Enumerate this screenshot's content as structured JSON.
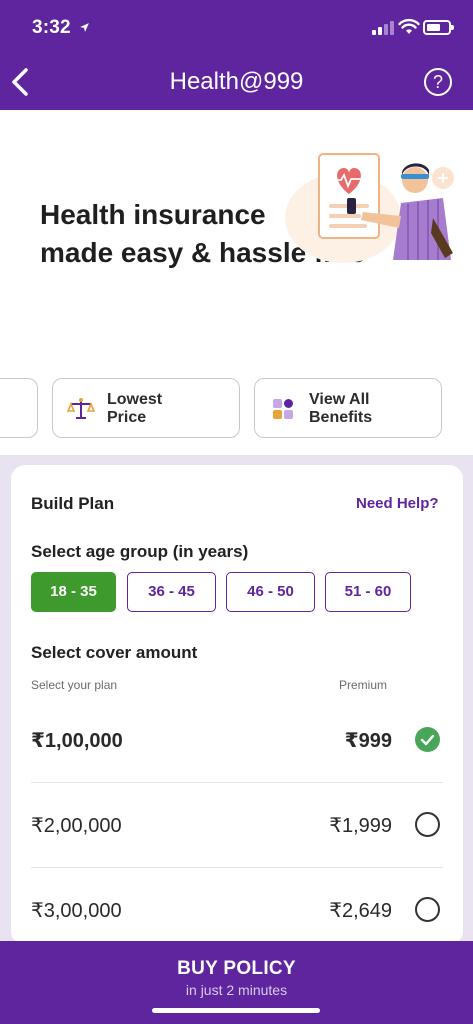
{
  "status_bar": {
    "time": "3:32",
    "location_icon": "location-arrow-icon"
  },
  "header": {
    "title": "Health@999",
    "back_icon": "back-arrow-icon",
    "help_icon": "question-circle-icon",
    "help_glyph": "?"
  },
  "hero": {
    "line1": "Health insurance",
    "line2": "made easy & hassle free"
  },
  "chips": [
    {
      "label": "Lowest\nPrice",
      "icon": "scale-icon"
    },
    {
      "label": "View All\nBenefits",
      "icon": "grid-icon"
    }
  ],
  "build_plan": {
    "title": "Build Plan",
    "need_help": "Need Help?",
    "age_title": "Select age group (in years)",
    "age_groups": [
      {
        "label": "18 - 35",
        "selected": true
      },
      {
        "label": "36 - 45",
        "selected": false
      },
      {
        "label": "46 - 50",
        "selected": false
      },
      {
        "label": "51 - 60",
        "selected": false
      }
    ],
    "cover_title": "Select cover amount",
    "col_plan": "Select your plan",
    "col_premium": "Premium",
    "plans": [
      {
        "amount": "₹1,00,000",
        "premium": "₹999",
        "selected": true
      },
      {
        "amount": "₹2,00,000",
        "premium": "₹1,999",
        "selected": false
      },
      {
        "amount": "₹3,00,000",
        "premium": "₹2,649",
        "selected": false
      }
    ]
  },
  "buy": {
    "label": "BUY POLICY",
    "sub": "in just 2 minutes"
  },
  "colors": {
    "brand": "#5f259f",
    "selected_green": "#3e9a2c",
    "check_green": "#49a55a",
    "card_bg": "#e9e3f1"
  }
}
